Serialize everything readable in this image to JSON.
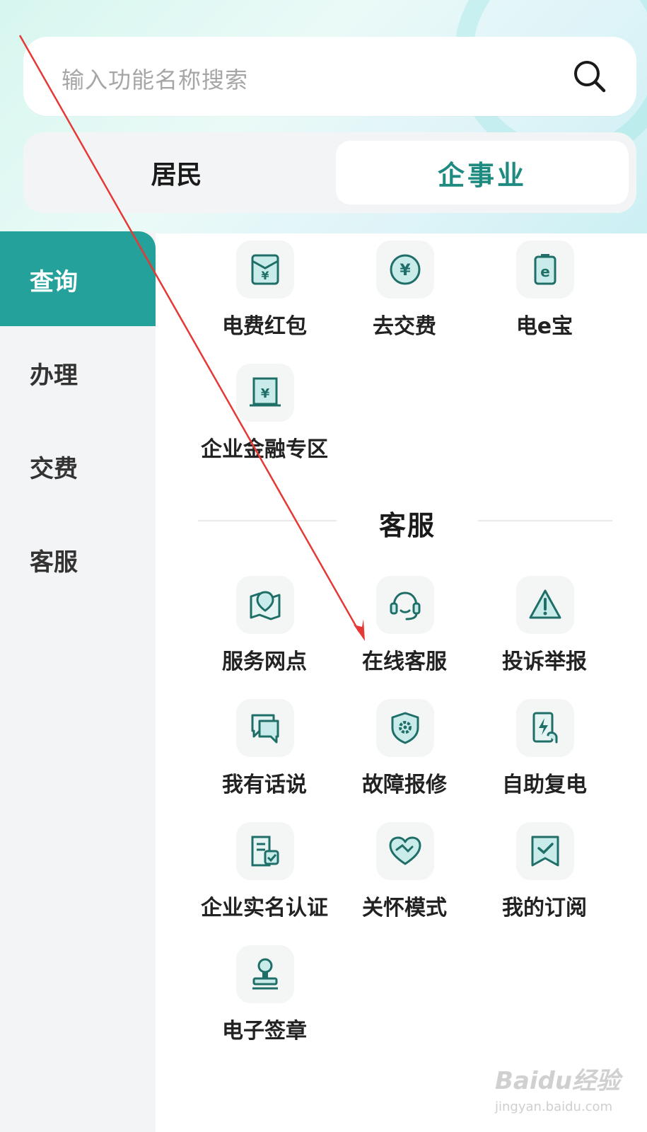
{
  "search": {
    "placeholder": "输入功能名称搜索"
  },
  "segment": {
    "left_label": "居民",
    "right_label": "企事业"
  },
  "sidebar": {
    "items": [
      {
        "label": "查询",
        "active": true
      },
      {
        "label": "办理",
        "active": false
      },
      {
        "label": "交费",
        "active": false
      },
      {
        "label": "客服",
        "active": false
      }
    ]
  },
  "query_section": {
    "items": [
      {
        "label": "电费红包",
        "icon": "red-envelope-icon"
      },
      {
        "label": "去交费",
        "icon": "yuan-coin-icon"
      },
      {
        "label": "电e宝",
        "icon": "battery-e-icon"
      },
      {
        "label": "企业金融专区",
        "icon": "finance-building-icon"
      }
    ]
  },
  "service_section": {
    "title": "客服",
    "items": [
      {
        "label": "服务网点",
        "icon": "map-pin-icon"
      },
      {
        "label": "在线客服",
        "icon": "headset-icon"
      },
      {
        "label": "投诉举报",
        "icon": "warning-icon"
      },
      {
        "label": "我有话说",
        "icon": "chat-icon"
      },
      {
        "label": "故障报修",
        "icon": "shield-gear-icon"
      },
      {
        "label": "自助复电",
        "icon": "power-restore-icon"
      },
      {
        "label": "企业实名认证",
        "icon": "company-verify-icon"
      },
      {
        "label": "关怀模式",
        "icon": "heart-handshake-icon"
      },
      {
        "label": "我的订阅",
        "icon": "bookmark-check-icon"
      },
      {
        "label": "电子签章",
        "icon": "stamp-icon"
      }
    ]
  },
  "watermark": {
    "brand": "Baidu经验",
    "url": "jingyan.baidu.com"
  },
  "colors": {
    "accent": "#24a19a",
    "accent_text": "#1f8a80",
    "annotation_arrow": "#e53935"
  }
}
